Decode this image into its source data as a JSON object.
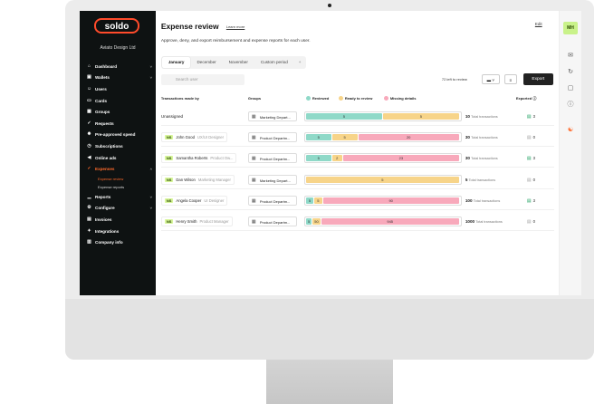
{
  "brand": {
    "logo": "soldo",
    "company": "Aviato Design Ltd"
  },
  "sidebar": {
    "items": [
      {
        "label": "Dashboard",
        "icon": "house-icon",
        "chevron": true
      },
      {
        "label": "Wallets",
        "icon": "wallet-icon",
        "chevron": true
      },
      {
        "label": "Users",
        "icon": "user-icon"
      },
      {
        "label": "Cards",
        "icon": "card-icon"
      },
      {
        "label": "Groups",
        "icon": "groups-icon"
      },
      {
        "label": "Requests",
        "icon": "check-icon"
      },
      {
        "label": "Pre-approved spend",
        "icon": "star-icon"
      },
      {
        "label": "Subscriptions",
        "icon": "clock-icon"
      },
      {
        "label": "Online ads",
        "icon": "megaphone-icon"
      },
      {
        "label": "Expenses",
        "icon": "check-icon",
        "chevron": true,
        "active": true
      },
      {
        "label": "Reports",
        "icon": "chart-icon",
        "chevron": true
      },
      {
        "label": "Configure",
        "icon": "gear-icon",
        "chevron": true
      },
      {
        "label": "Invoices",
        "icon": "invoice-icon"
      },
      {
        "label": "Integrations",
        "icon": "puzzle-icon"
      },
      {
        "label": "Company info",
        "icon": "building-icon"
      }
    ],
    "sub_items": [
      "Expense review",
      "Expense reports"
    ]
  },
  "header": {
    "title": "Expense review",
    "learn_more": "Learn more",
    "edit": "Edit",
    "subtitle": "Approve, deny, and export reimbursement and expense reports for each user."
  },
  "tabs": [
    "January",
    "December",
    "November",
    "Custom period",
    "+"
  ],
  "search": {
    "placeholder": "Search user"
  },
  "toolbar": {
    "left_to_review": "72 left to review",
    "export_label": "Export"
  },
  "table": {
    "headers": {
      "user": "Transactions made by",
      "groups": "Groups",
      "reviewed": "Reviewed",
      "ready": "Ready to review",
      "missing": "Missing details",
      "exported": "Exported"
    },
    "rows": [
      {
        "initials": "",
        "name": "Unassigned",
        "role": "",
        "group": "Marketing Depart...",
        "reviewed": 5,
        "ready": 5,
        "missing": 0,
        "total": "10",
        "total_label": "Total transactions",
        "exported": "3",
        "exported_state": "green"
      },
      {
        "initials": "NS",
        "name": "John Good",
        "role": "UX/UI Designer",
        "group": "Product Departm...",
        "reviewed": 5,
        "ready": 5,
        "missing": 20,
        "total": "30",
        "total_label": "Total transactions",
        "exported": "0",
        "exported_state": "grey"
      },
      {
        "initials": "NS",
        "name": "Samantha Roberts",
        "role": "Product Ow...",
        "group": "Product Departm...",
        "reviewed": 5,
        "ready": 2,
        "missing": 23,
        "total": "30",
        "total_label": "Total transactions",
        "exported": "3",
        "exported_state": "green"
      },
      {
        "initials": "NS",
        "name": "Dan Wilson",
        "role": "Marketing Manager",
        "group": "Marketing Depart...",
        "reviewed": 0,
        "ready": 5,
        "missing": 0,
        "total": "5",
        "total_label": "Total transactions",
        "exported": "0",
        "exported_state": "grey"
      },
      {
        "initials": "NS",
        "name": "Angela Cooper",
        "role": "UI Designer",
        "group": "Product Departm...",
        "reviewed": 5,
        "ready": 5,
        "missing": 90,
        "total": "100",
        "total_label": "Total transactions",
        "exported": "3",
        "exported_state": "green"
      },
      {
        "initials": "NS",
        "name": "Henry Smith",
        "role": "Product Manager",
        "group": "Product Departm...",
        "reviewed": 5,
        "ready": 50,
        "missing": 945,
        "total": "1000",
        "total_label": "Total transactions",
        "exported": "0",
        "exported_state": "grey"
      }
    ]
  },
  "rail": {
    "avatar": "MH"
  },
  "colors": {
    "reviewed": "#8fd9c8",
    "ready": "#f7d489",
    "missing": "#f8a9bb",
    "accent": "#ff6a2b"
  }
}
